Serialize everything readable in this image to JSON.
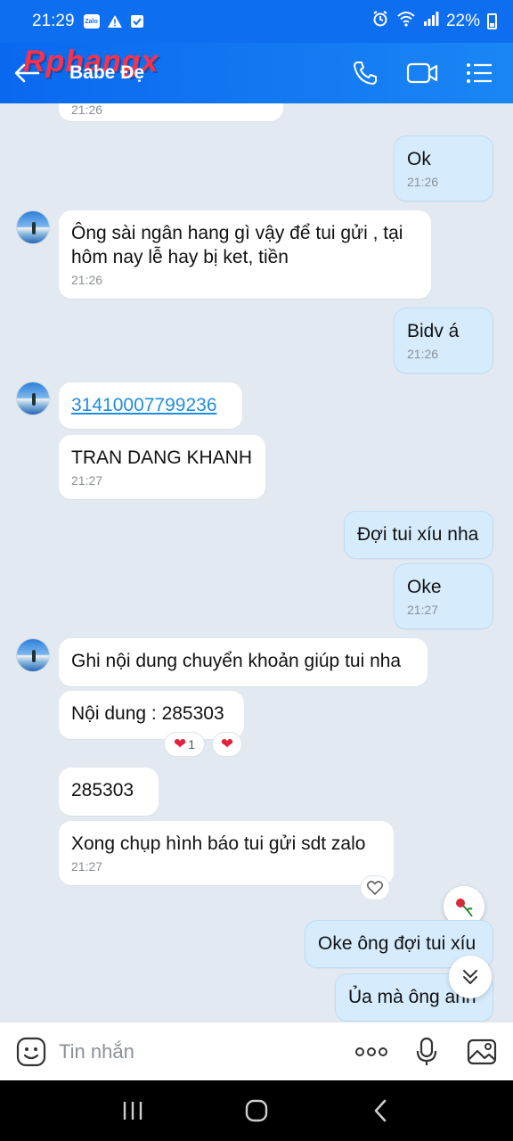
{
  "status_bar": {
    "time": "21:29",
    "app_badge": "Zalo",
    "battery": "22%"
  },
  "header": {
    "title": "Babe Đẹ",
    "watermark": "Rphangx"
  },
  "messages": {
    "m0_time": "21:26",
    "m1_text": "Ok",
    "m1_time": "21:26",
    "m2_text_line1": "Ông sài ngân hang gì vậy để tui gửi , tại",
    "m2_text_line2": "hôm nay lễ hay bị ket, tiền",
    "m2_time": "21:26",
    "m3_text": "Bidv á",
    "m3_time": "21:26",
    "m4_text": "31410007799236",
    "m5_text": "TRAN DANG KHANH",
    "m5_time": "21:27",
    "m6_text": "Đợi tui xíu nha",
    "m7_text": "Oke",
    "m7_time": "21:27",
    "m8_text": "Ghi nội dung chuyển khoản giúp tui nha",
    "m9_text": "Nội dung : 285303",
    "m9_reaction_count": "1",
    "m10_text": "285303",
    "m11_text": "Xong chụp hình báo tui gửi sdt zalo",
    "m11_time": "21:27",
    "m12_text": "Oke ông đợi tui xíu",
    "m13_text": "Ủa mà ông anh"
  },
  "input": {
    "placeholder": "Tin nhắn"
  },
  "colors": {
    "header_blue": "#0a68ef",
    "bubble_out": "#d6ecfd",
    "bubble_in": "#ffffff",
    "chat_bg": "#e2e9f1",
    "heart": "#e0233b"
  },
  "icons": {
    "back": "back-arrow-icon",
    "call": "phone-icon",
    "video": "video-camera-icon",
    "menu": "list-menu-icon",
    "emoji": "emoji-icon",
    "more": "more-dots-icon",
    "mic": "microphone-icon",
    "image": "image-icon"
  }
}
